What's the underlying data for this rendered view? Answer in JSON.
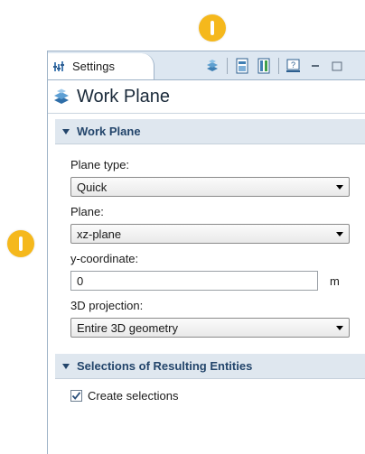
{
  "panel": {
    "tab_label": "Settings",
    "header_title": "Work Plane"
  },
  "sections": [
    {
      "title": "Work Plane",
      "expanded": true
    },
    {
      "title": "Selections of Resulting Entities",
      "expanded": true
    }
  ],
  "form": {
    "plane_type_label": "Plane type:",
    "plane_type_value": "Quick",
    "plane_label": "Plane:",
    "plane_value": "xz-plane",
    "y_coord_label": "y-coordinate:",
    "y_coord_value": "0",
    "y_coord_unit": "m",
    "projection_label": "3D projection:",
    "projection_value": "Entire 3D geometry"
  },
  "selections": {
    "create_label": "Create selections",
    "create_checked": true
  },
  "colors": {
    "marker": "#f5b81c",
    "section_title": "#23456b",
    "tab_bar": "#dde7f1"
  },
  "icons": [
    "settings-icon",
    "work-plane-icon",
    "build-icon",
    "window-icon",
    "panel-icon",
    "help-icon",
    "minimize-icon",
    "maximize-icon",
    "caret-down-icon",
    "dropdown-arrow-icon",
    "checkmark-icon"
  ]
}
